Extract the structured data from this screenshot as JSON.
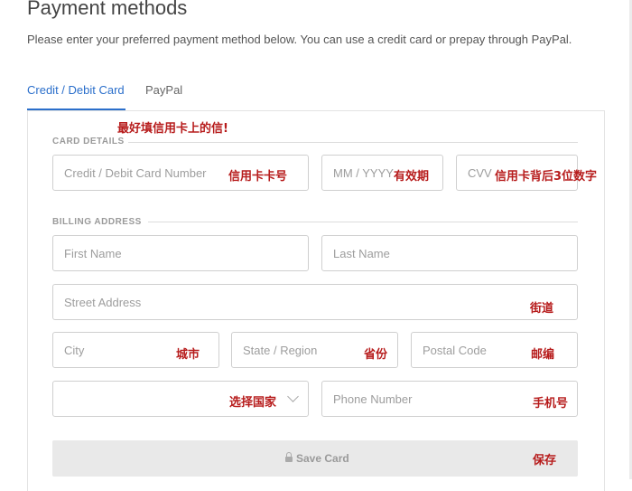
{
  "page": {
    "title": "Payment methods",
    "subtitle": "Please enter your preferred payment method below. You can use a credit card or prepay through PayPal."
  },
  "tabs": [
    {
      "label": "Credit / Debit Card",
      "active": true
    },
    {
      "label": "PayPal",
      "active": false
    }
  ],
  "annotations": {
    "fill_info": "最好填信用卡上的信!",
    "card_number": "信用卡卡号",
    "expiry": "有效期",
    "cvv": "信用卡背后3位数字",
    "street": "街道",
    "city": "城市",
    "state": "省份",
    "postal": "邮编",
    "country": "选择国家",
    "phone": "手机号",
    "save": "保存"
  },
  "card_details": {
    "label": "CARD DETAILS",
    "number_placeholder": "Credit / Debit Card Number",
    "expiry_placeholder": "MM / YYYY",
    "cvv_placeholder": "CVV"
  },
  "billing": {
    "label": "BILLING ADDRESS",
    "first_name_placeholder": "First Name",
    "last_name_placeholder": "Last Name",
    "street_placeholder": "Street Address",
    "city_placeholder": "City",
    "state_placeholder": "State / Region",
    "postal_placeholder": "Postal Code",
    "country_value": "",
    "phone_placeholder": "Phone Number"
  },
  "actions": {
    "save_label": "Save Card",
    "save_icon": "lock-icon"
  },
  "colors": {
    "accent": "#2b6fcb",
    "annotation": "#b71c1c",
    "button_bg": "#e9e9e9"
  }
}
